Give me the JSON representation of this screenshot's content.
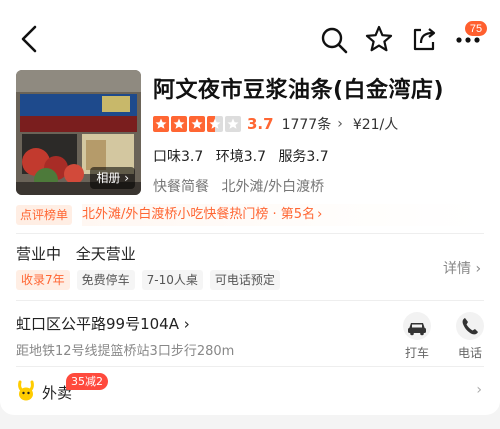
{
  "header": {
    "notification_count": "75"
  },
  "icons": {
    "back": "back-arrow-icon",
    "search": "search-icon",
    "favorite": "star-outline-icon",
    "share": "share-icon",
    "more": "more-dots-icon"
  },
  "shop": {
    "name": "阿文夜市豆浆油条(白金湾店)",
    "album_label": "相册",
    "rating": {
      "score": "3.7",
      "stars_value": 3.5,
      "stars_max": 5,
      "reviews": "1777条",
      "price": "¥21/人"
    },
    "sub_scores": [
      "口味3.7",
      "环境3.7",
      "服务3.7"
    ],
    "category": [
      "快餐简餐",
      "北外滩/外白渡桥"
    ],
    "rank": {
      "tag": "点评榜单",
      "text": "北外滩/外白渡桥小吃快餐热门榜 · 第5名",
      "chevron": "›"
    }
  },
  "hours": {
    "status": "营业中",
    "schedule": "全天营业",
    "details_label": "详情",
    "tags": [
      "收录7年",
      "免费停车",
      "7-10人桌",
      "可电话预定"
    ]
  },
  "location": {
    "address": "虹口区公平路99号104A",
    "metro": "距地铁12号线提篮桥站3口步行280m",
    "actions": [
      "打车",
      "电话"
    ]
  },
  "takeaway": {
    "label": "外卖",
    "promo": "35减2",
    "chevron": "›"
  },
  "colors": {
    "accent": "#ff6633",
    "badge": "#ff5f2e",
    "promo": "#ff4a3d",
    "star_fill": "#ff6633",
    "star_empty": "#dddddd"
  }
}
